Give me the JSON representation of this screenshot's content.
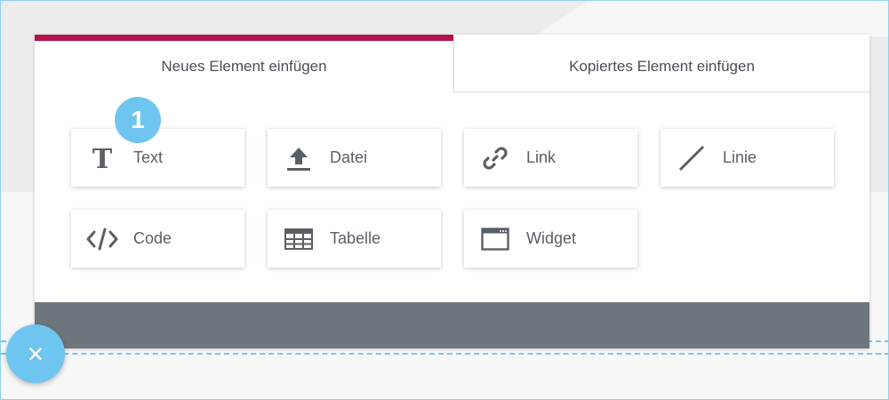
{
  "tabs": [
    {
      "label": "Neues Element einfügen",
      "active": true
    },
    {
      "label": "Kopiertes Element einfügen",
      "active": false
    }
  ],
  "badge": {
    "number": "1"
  },
  "elements": [
    {
      "label": "Text",
      "icon": "text-icon"
    },
    {
      "label": "Datei",
      "icon": "upload-icon"
    },
    {
      "label": "Link",
      "icon": "link-icon"
    },
    {
      "label": "Linie",
      "icon": "line-icon"
    },
    {
      "label": "Code",
      "icon": "code-icon"
    },
    {
      "label": "Tabelle",
      "icon": "table-icon"
    },
    {
      "label": "Widget",
      "icon": "widget-icon"
    }
  ],
  "close_button": {
    "symbol": "×"
  },
  "colors": {
    "active_tab_accent": "#b5124f",
    "primary_blue": "#6ec5ef",
    "footer_gray": "#6e767d",
    "icon_gray": "#5a5f66"
  }
}
